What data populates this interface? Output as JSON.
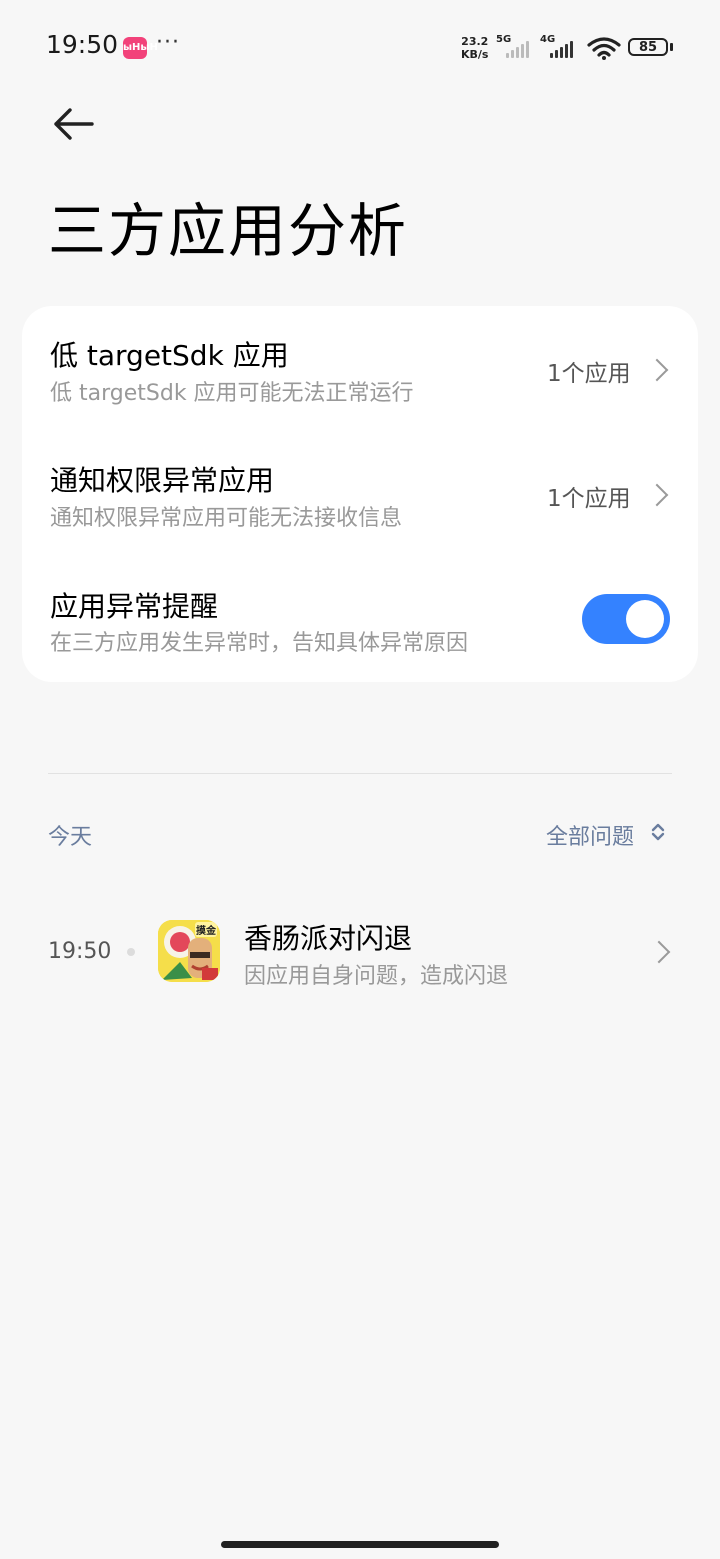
{
  "status_bar": {
    "time": "19:50",
    "app_icon_text": "ыНыН",
    "more": "···",
    "speed_value": "23.2",
    "speed_unit": "KB/s",
    "net1": "5G",
    "net2": "4G",
    "battery": "85"
  },
  "header": {
    "title": "三方应用分析"
  },
  "settings": {
    "low_sdk": {
      "title": "低 targetSdk 应用",
      "subtitle": "低 targetSdk 应用可能无法正常运行",
      "value": "1个应用"
    },
    "notify": {
      "title": "通知权限异常应用",
      "subtitle": "通知权限异常应用可能无法接收信息",
      "value": "1个应用"
    },
    "reminder": {
      "title": "应用异常提醒",
      "subtitle": "在三方应用发生异常时，告知具体异常原因",
      "enabled": true
    }
  },
  "log": {
    "date_label": "今天",
    "filter_label": "全部问题",
    "events": [
      {
        "time": "19:50",
        "title": "香肠派对闪退",
        "subtitle": "因应用自身问题，造成闪退",
        "icon_badge": "摸金"
      }
    ]
  }
}
